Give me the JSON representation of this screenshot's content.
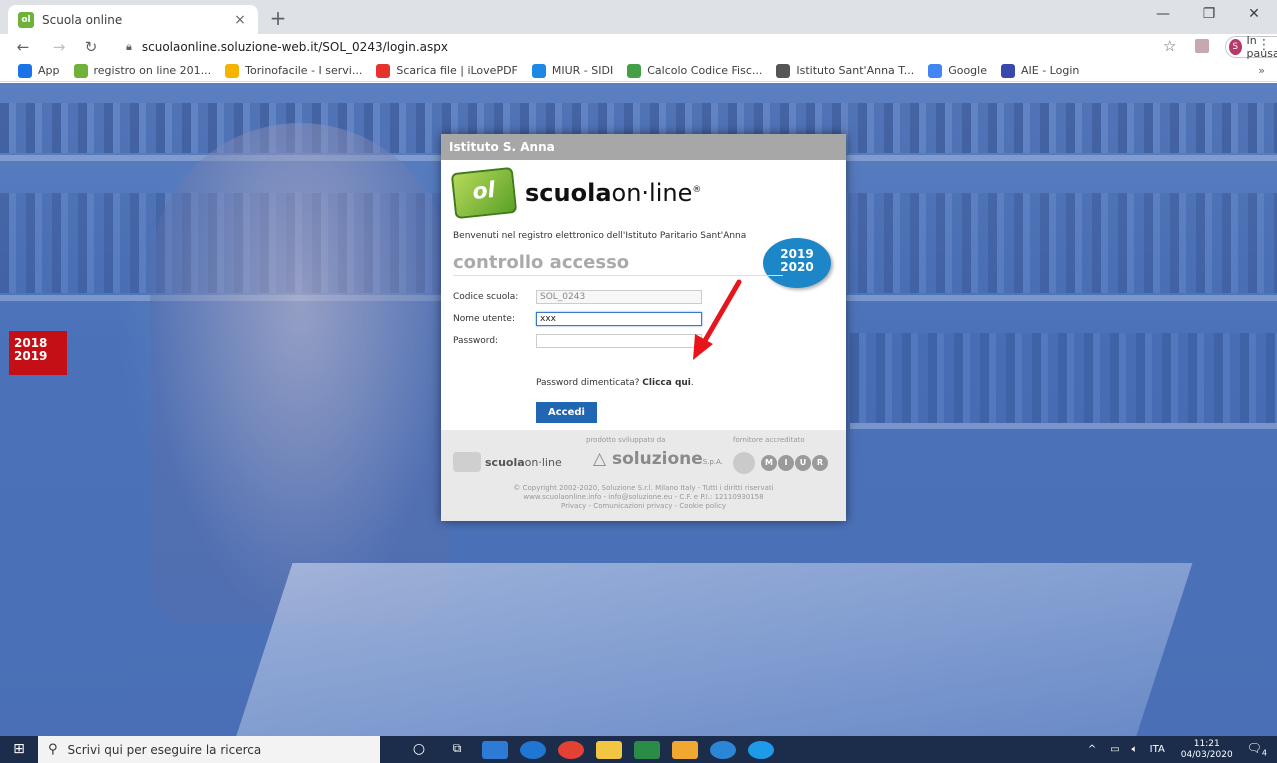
{
  "browser": {
    "tab_title": "Scuola online",
    "tab_close": "×",
    "new_tab": "+",
    "url": "scuolaonline.soluzione-web.it/SOL_0243/login.aspx",
    "profile_initial": "S",
    "profile_label": "In pausa",
    "window_minimize": "—",
    "window_restore": "❐",
    "window_close": "✕"
  },
  "bookmarks": [
    {
      "label": "App",
      "icon": "apps-grid-icon",
      "color": "#1a73e8"
    },
    {
      "label": "registro on line 201...",
      "icon": "scuolaonline-icon",
      "color": "#6fb23a"
    },
    {
      "label": "Torinofacile - I servi...",
      "icon": "torinofacile-icon",
      "color": "#f4b400"
    },
    {
      "label": "Scarica file | iLovePDF",
      "icon": "ilovepdf-icon",
      "color": "#e5322d"
    },
    {
      "label": "MIUR - SIDI",
      "icon": "miur-icon",
      "color": "#1e88e5"
    },
    {
      "label": "Calcolo Codice Fisc...",
      "icon": "codicefiscale-icon",
      "color": "#43a047"
    },
    {
      "label": "Istituto Sant'Anna T...",
      "icon": "globe-icon",
      "color": "#555555"
    },
    {
      "label": "Google",
      "icon": "google-icon",
      "color": "#4285f4"
    },
    {
      "label": "AIE - Login",
      "icon": "aie-icon",
      "color": "#3949ab"
    }
  ],
  "bookmarks_more": "»",
  "page": {
    "year_left_1": "2018",
    "year_left_2": "2019",
    "panel_header": "Istituto S. Anna",
    "logo_mark": "ol",
    "logo_bold": "scuola",
    "logo_light": "on·line",
    "logo_reg": "®",
    "welcome": "Benvenuti nel registro elettronico dell'Istituto Paritario Sant'Anna",
    "year_badge_1": "2019",
    "year_badge_2": "2020",
    "access_title": "controllo accesso",
    "fields": {
      "codice_label": "Codice scuola:",
      "codice_value": "SOL_0243",
      "utente_label": "Nome utente:",
      "utente_value": "xxx",
      "password_label": "Password:",
      "password_value": ""
    },
    "forgot_text": "Password dimenticata? ",
    "forgot_link": "Clicca qui",
    "forgot_end": ".",
    "login_button": "Accedi",
    "footer": {
      "label_dev": "prodotto sviluppato da",
      "label_supplier": "fornitore accreditato",
      "brand1_bold": "scuola",
      "brand1_light": "on·line",
      "brand2": "soluzione",
      "brand2_suffix": "S.p.A.",
      "miur_letters": [
        "M",
        "I",
        "U",
        "R"
      ],
      "copyright_1": "© Copyright 2002-2020, Soluzione S.r.l. Milano Italy - Tutti i diritti riservati",
      "copyright_2": "www.scuolaonline.info - info@soluzione.eu - C.F. e P.I.: 12110930158",
      "copyright_3": "Privacy - Comunicazioni privacy - Cookie policy"
    }
  },
  "taskbar": {
    "search_placeholder": "Scrivi qui per eseguire la ricerca",
    "language": "ITA",
    "time": "11:21",
    "date": "04/03/2020",
    "notifications": "4"
  },
  "colors": {
    "accent_blue": "#2166b3",
    "badge_red": "#c40f16",
    "badge_blue": "#1d86c7",
    "arrow_red": "#e8141b"
  }
}
